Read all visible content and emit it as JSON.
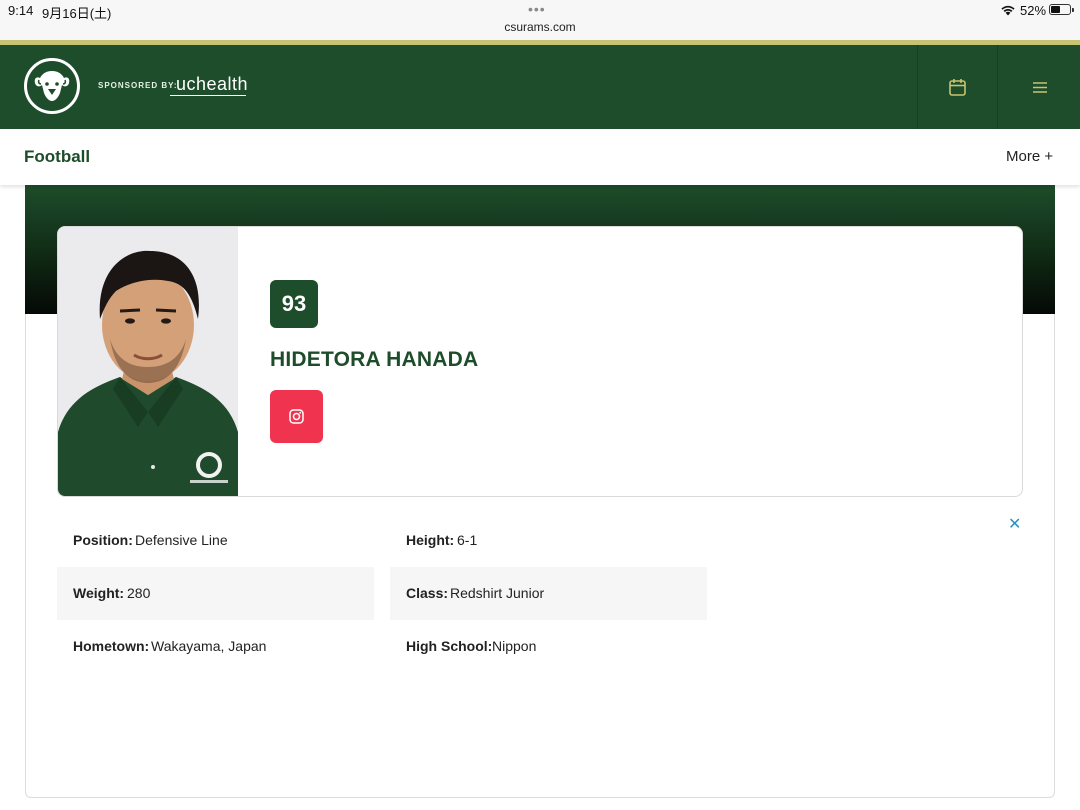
{
  "status_bar": {
    "time": "9:14",
    "date": "9月16日(土)",
    "url": "csurams.com",
    "battery": "52%",
    "battery_level": 0.52
  },
  "header": {
    "sponsor_label": "SPONSORED BY:",
    "sponsor_brand": "uchealth",
    "logo_icon": "ram-head-logo",
    "calendar_icon": "calendar-icon",
    "menu_icon": "hamburger-menu-icon"
  },
  "subnav": {
    "title": "Football",
    "more_label": "More +"
  },
  "player": {
    "jersey_number": "93",
    "name": "HIDETORA HANADA",
    "social_icon": "instagram-icon"
  },
  "bio": [
    {
      "label": "Position:",
      "value": "Defensive Line"
    },
    {
      "label": "Height:",
      "value": "6-1"
    },
    {
      "label": "Weight:",
      "value": "280"
    },
    {
      "label": "Class:",
      "value": "Redshirt Junior"
    },
    {
      "label": "Hometown:",
      "value": "Wakayama, Japan"
    },
    {
      "label": "High School:",
      "value": "Nippon"
    }
  ],
  "ad": {
    "close_label": "✕"
  },
  "colors": {
    "brand_green": "#1e4d2b",
    "gold": "#c8c372",
    "instagram": "#f0344f",
    "close_blue": "#2c8fc4"
  }
}
